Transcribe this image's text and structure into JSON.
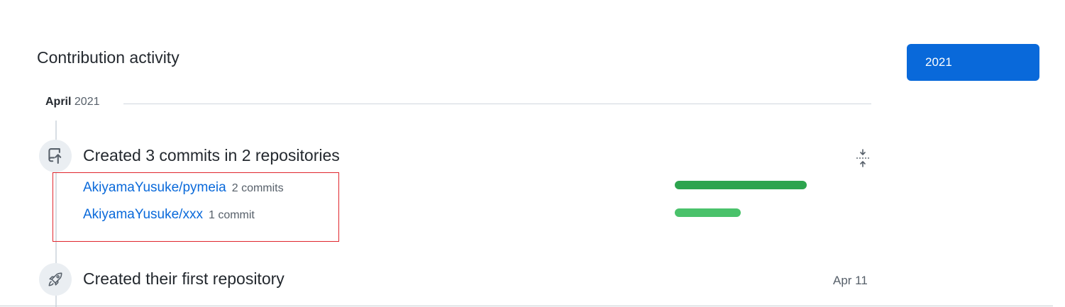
{
  "section": {
    "title": "Contribution activity"
  },
  "year_filter": {
    "selected": "2021"
  },
  "month": {
    "name": "April",
    "year": "2021"
  },
  "commits_event": {
    "title": "Created 3 commits in 2 repositories",
    "icon": "repo-push-icon",
    "repositories": [
      {
        "name": "AkiyamaYusuke/pymeia",
        "count": "2 commits",
        "share": 2
      },
      {
        "name": "AkiyamaYusuke/xxx",
        "count": "1 commit",
        "share": 1
      }
    ],
    "bar_colors": [
      "#2da44e",
      "#4ac26b"
    ]
  },
  "repo_event": {
    "title": "Created their first repository",
    "icon": "rocket-icon",
    "date": "Apr 11"
  },
  "colors": {
    "accent": "#0969da",
    "highlight_border": "#e0262d"
  }
}
